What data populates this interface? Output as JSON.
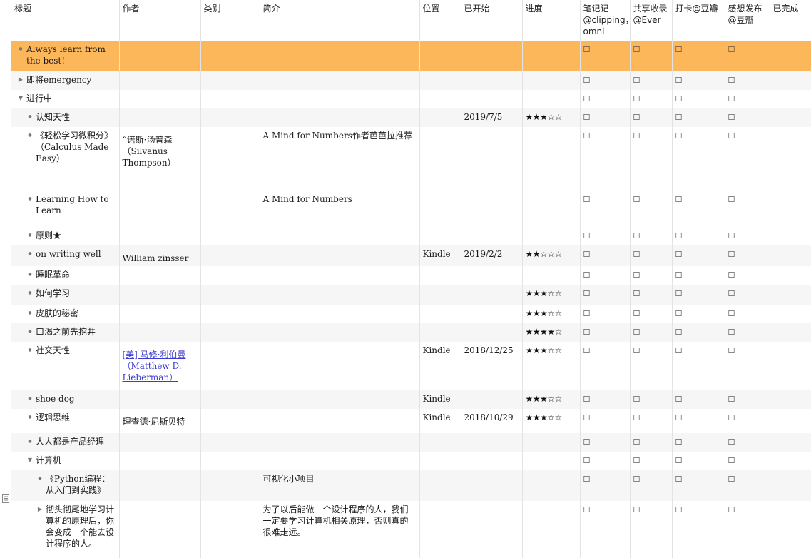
{
  "columns": [
    "标题",
    "作者",
    "类别",
    "简介",
    "位置",
    "已开始",
    "进度",
    "笔记记@clipping，omni",
    "共享收录@Ever",
    "打卡@豆瓣",
    "感想发布@豆瓣",
    "已完成"
  ],
  "checkbox_glyph": "☐",
  "highlight_color": "#fdb75b",
  "rows": [
    {
      "title": "Always learn from the best!",
      "author": "",
      "category": "",
      "summary": "",
      "location": "",
      "started": "",
      "progress": ""
    },
    {
      "title": "即将emergency",
      "author": "",
      "category": "",
      "summary": "",
      "location": "",
      "started": "",
      "progress": ""
    },
    {
      "title": "进行中",
      "author": "",
      "category": "",
      "summary": "",
      "location": "",
      "started": "",
      "progress": ""
    },
    {
      "title": "认知天性",
      "author": "",
      "category": "",
      "summary": "",
      "location": "",
      "started": "2019/7/5",
      "progress": "★★★☆☆"
    },
    {
      "title": "《轻松学习微积分》（Calculus Made Easy）",
      "author": "“诺斯·汤普森 （Silvanus Thompson）",
      "category": "",
      "summary": "A Mind for Numbers作者芭芭拉推荐",
      "location": "",
      "started": "",
      "progress": ""
    },
    {
      "title": "Learning How to Learn",
      "author": "",
      "category": "",
      "summary": "A Mind for Numbers",
      "location": "",
      "started": "",
      "progress": ""
    },
    {
      "title": "原则★",
      "author": "",
      "category": "",
      "summary": "",
      "location": "",
      "started": "",
      "progress": ""
    },
    {
      "title": "on writing well",
      "author": "William zinsser",
      "category": "",
      "summary": "",
      "location": "Kindle",
      "started": "2019/2/2",
      "progress": "★★☆☆☆"
    },
    {
      "title": "睡眠革命",
      "author": "",
      "category": "",
      "summary": "",
      "location": "",
      "started": "",
      "progress": ""
    },
    {
      "title": "如何学习",
      "author": "",
      "category": "",
      "summary": "",
      "location": "",
      "started": "",
      "progress": "★★★☆☆"
    },
    {
      "title": "皮肤的秘密",
      "author": "",
      "category": "",
      "summary": "",
      "location": "",
      "started": "",
      "progress": "★★★☆☆"
    },
    {
      "title": "口渴之前先挖井",
      "author": "",
      "category": "",
      "summary": "",
      "location": "",
      "started": "",
      "progress": "★★★★☆"
    },
    {
      "title": "社交天性",
      "author": "[美] 马修·利伯曼 （Matthew D. Lieberman）",
      "category": "",
      "summary": "",
      "location": "Kindle",
      "started": "2018/12/25",
      "progress": "★★★☆☆"
    },
    {
      "title": "shoe dog",
      "author": "",
      "category": "",
      "summary": "",
      "location": "Kindle",
      "started": "",
      "progress": "★★★☆☆"
    },
    {
      "title": "逻辑思维",
      "author": "理查德·尼斯贝特",
      "category": "",
      "summary": "",
      "location": "Kindle",
      "started": "2018/10/29",
      "progress": "★★★☆☆"
    },
    {
      "title": "人人都是产品经理",
      "author": "",
      "category": "",
      "summary": "",
      "location": "",
      "started": "",
      "progress": ""
    },
    {
      "title": "计算机",
      "author": "",
      "category": "",
      "summary": "",
      "location": "",
      "started": "",
      "progress": ""
    },
    {
      "title": "《Python编程：从入门到实践》",
      "author": "",
      "category": "",
      "summary": "可视化小项目",
      "location": "",
      "started": "",
      "progress": ""
    },
    {
      "title": "彻头彻尾地学习计算机的原理后，你会变成一个能去设计程序的人。",
      "author": "",
      "category": "",
      "summary": "为了以后能做一个设计程序的人，我们一定要学习计算机相关原理，否则真的很难走远。",
      "location": "",
      "started": "",
      "progress": ""
    }
  ]
}
